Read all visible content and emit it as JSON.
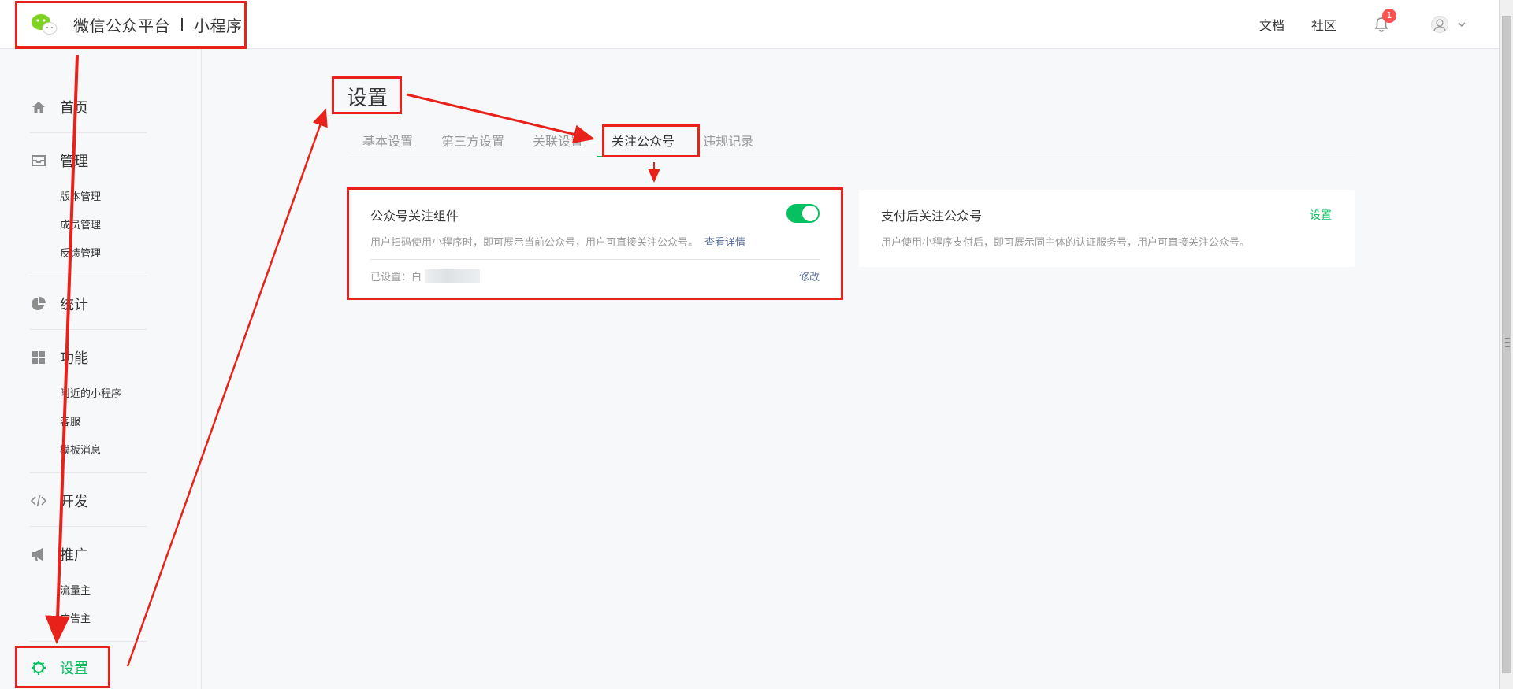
{
  "header": {
    "brand_name": "微信公众平台",
    "brand_product": "小程序",
    "links": [
      "文档",
      "社区"
    ],
    "notification_count": "1"
  },
  "sidebar": {
    "home": "首页",
    "manage": {
      "label": "管理",
      "items": [
        "版本管理",
        "成员管理",
        "反馈管理"
      ]
    },
    "stats": "统计",
    "features": {
      "label": "功能",
      "items": [
        "附近的小程序",
        "客服",
        "模板消息"
      ]
    },
    "develop": "开发",
    "promote": {
      "label": "推广",
      "items": [
        "流量主",
        "广告主"
      ]
    },
    "settings": "设置"
  },
  "main": {
    "title": "设置",
    "tabs": [
      "基本设置",
      "第三方设置",
      "关联设置",
      "关注公众号",
      "违规记录"
    ],
    "active_tab_index": 3
  },
  "card_follow": {
    "title": "公众号关注组件",
    "desc": "用户扫码使用小程序时，即可展示当前公众号，用户可直接关注公众号。",
    "more": "查看详情",
    "status_prefix": "已设置：白",
    "edit": "修改",
    "enabled": true
  },
  "card_pay": {
    "title": "支付后关注公众号",
    "desc": "用户使用小程序支付后，即可展示同主体的认证服务号，用户可直接关注公众号。",
    "action": "设置"
  },
  "colors": {
    "accent": "#07c160",
    "link": "#576b95",
    "annotation": "#e8221b",
    "badge": "#fa5151"
  }
}
